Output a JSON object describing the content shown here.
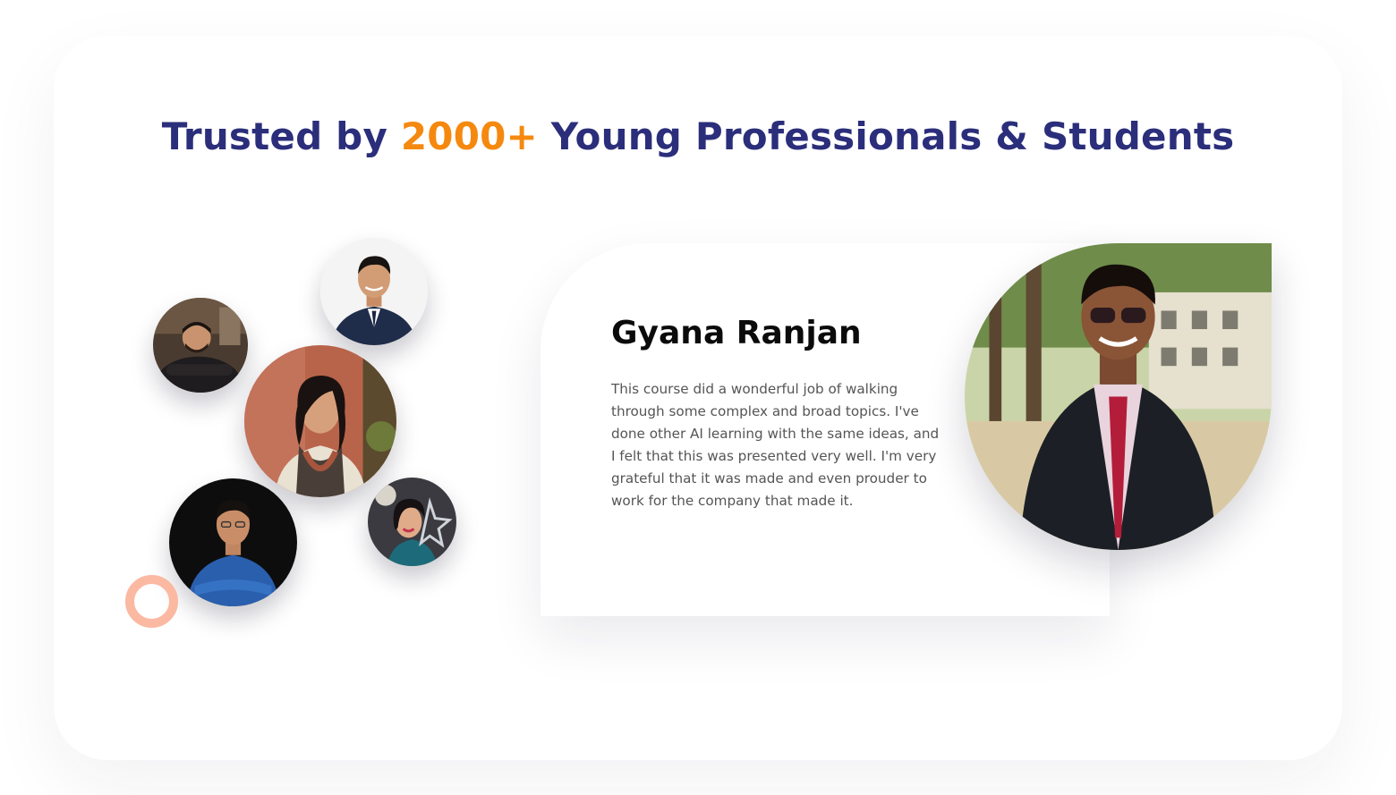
{
  "section": {
    "heading_prefix": "Trusted by",
    "heading_highlight": "2000+",
    "heading_suffix": "Young Professionals & Students",
    "heading_color": "#2b2e7a",
    "highlight_color": "#f5890f"
  },
  "avatars": [
    {
      "label": "student-avatar-1"
    },
    {
      "label": "student-avatar-2"
    },
    {
      "label": "student-avatar-3"
    },
    {
      "label": "student-avatar-4"
    },
    {
      "label": "student-avatar-5"
    }
  ],
  "testimonial": {
    "name": "Gyana Ranjan",
    "quote": "This course did a wonderful job of walking through some complex and broad topics. I've done other AI learning with the same ideas, and I felt that this was presented very well. I'm very grateful that it was made and even prouder to work for the company that made it."
  },
  "colors": {
    "ring": "#fbb9a2",
    "name_text": "#0b0b0b",
    "quote_text": "#555555"
  }
}
